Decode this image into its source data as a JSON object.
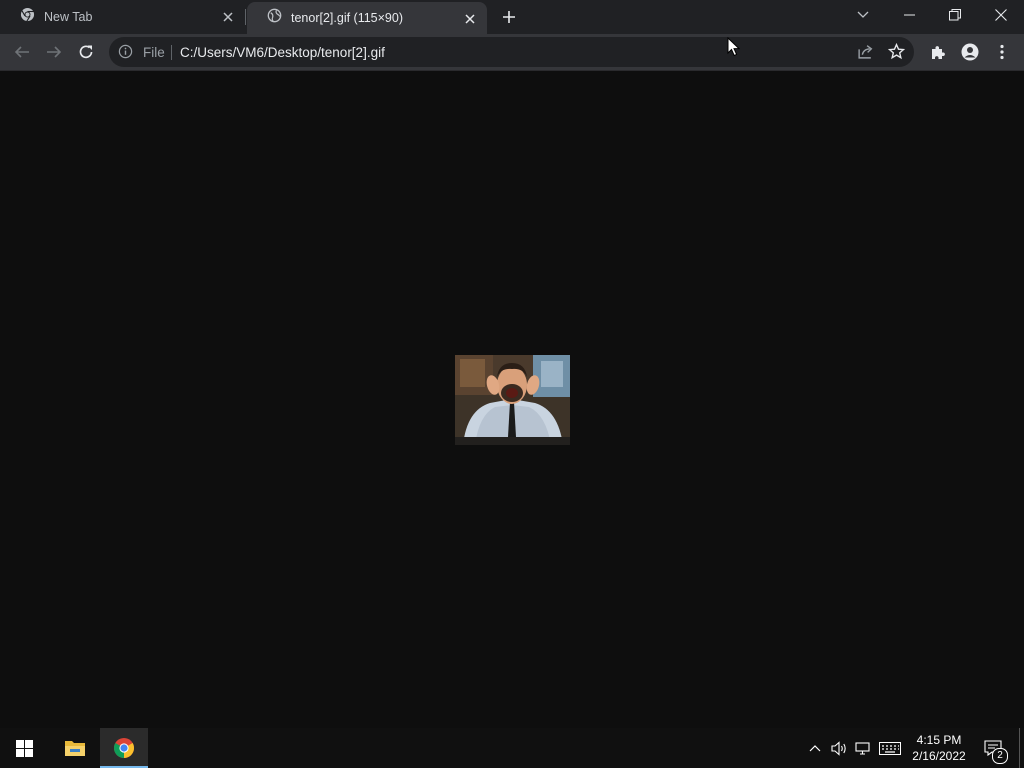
{
  "tabs": [
    {
      "title": "New Tab",
      "icon": "chrome-icon"
    },
    {
      "title": "tenor[2].gif (115×90)",
      "icon": "globe-icon"
    }
  ],
  "omnibox": {
    "security_label": "File",
    "url": "C:/Users/VM6/Desktop/tenor[2].gif"
  },
  "content": {
    "image_alt": "tenor[2].gif",
    "background": "#0e0e0e"
  },
  "taskbar": {
    "apps": [
      "start-icon",
      "file-explorer-icon",
      "chrome-icon"
    ],
    "time": "4:15 PM",
    "date": "2/16/2022",
    "notification_count": "2"
  },
  "colors": {
    "tabstrip": "#202124",
    "active_tab": "#35363a",
    "omnibox": "#202124",
    "taskbar": "#101010"
  }
}
